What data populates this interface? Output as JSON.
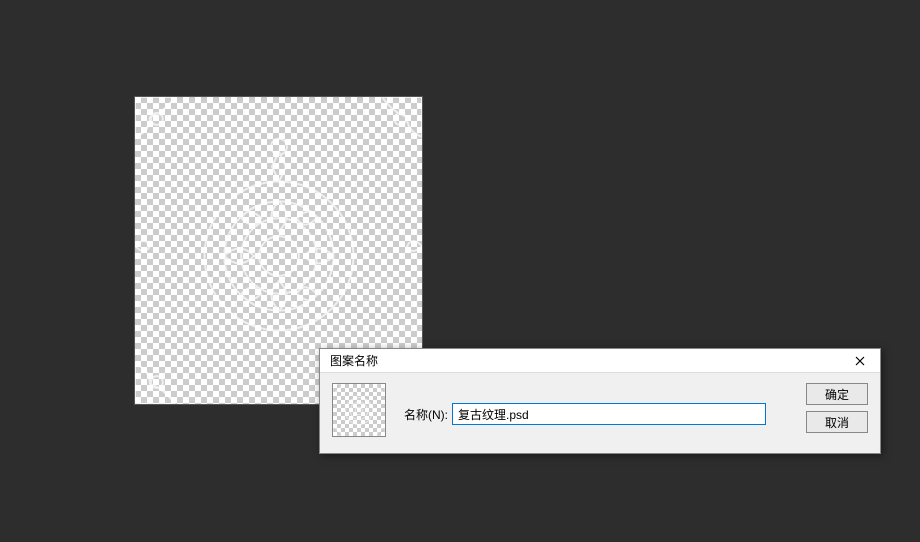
{
  "dialog": {
    "title": "图案名称",
    "name_label": "名称(N):",
    "name_value": "复古纹理.psd",
    "ok_label": "确定",
    "cancel_label": "取消"
  }
}
